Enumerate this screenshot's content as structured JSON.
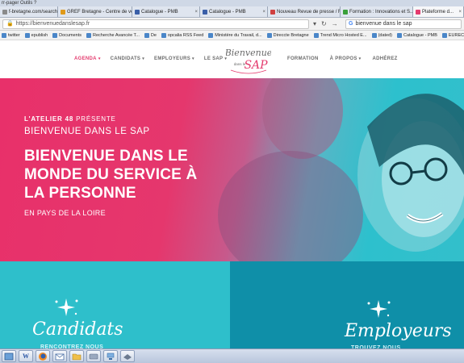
{
  "browser": {
    "top_strip": "rr-pager   Outils   ?",
    "tabs": [
      {
        "label": "f-bretagne.com/search?s=...",
        "color": "#8a8a8a",
        "width": 72
      },
      {
        "label": "GREF Bretagne - Centre de ve...",
        "color": "#e09a1a",
        "width": 92
      },
      {
        "label": "Catalogue - PMB",
        "color": "#3a5fa8",
        "width": 84
      },
      {
        "label": "Catalogue - PMB",
        "color": "#3a5fa8",
        "width": 84
      },
      {
        "label": "Nouveau Revue de presse / R...",
        "color": "#d04040",
        "width": 90
      },
      {
        "label": "Formation : Innovations et S...",
        "color": "#3aa03a",
        "width": 90
      },
      {
        "label": "Plateforme d...",
        "color": "#e43b6e",
        "width": 63,
        "active": true
      }
    ],
    "url": "https://bienvenuedanslesap.fr",
    "search_value": "bienvenue dans le sap",
    "bookmarks": [
      "twitter",
      "epublish",
      "Documents",
      "Recherche Avancée T...",
      "De",
      "opcalia RSS Feed",
      "Ministère du Travail, d...",
      "Direccte Bretagne",
      "Trend Micro Hosted E...",
      "(dated)",
      "Catalogue - PMB",
      "EURECIA / ENTREZ DA..."
    ]
  },
  "site": {
    "nav_left": [
      {
        "label": "AGENDA",
        "caret": "▾",
        "active": true
      },
      {
        "label": "CANDIDATS",
        "caret": "▾"
      },
      {
        "label": "EMPLOYEURS",
        "caret": "▾"
      },
      {
        "label": "LE SAP",
        "caret": "▾"
      }
    ],
    "nav_right": [
      {
        "label": "FORMATION",
        "caret": ""
      },
      {
        "label": "À PROPOS",
        "caret": "▾"
      },
      {
        "label": "ADHÉREZ",
        "caret": ""
      }
    ],
    "logo": {
      "line1": "Bienvenue",
      "line2": "dans le",
      "line3": "SAP"
    }
  },
  "hero": {
    "kicker_bold": "L'ATELIER 48",
    "kicker_light": " PRÉSENTE",
    "subtitle": "BIENVENUE DANS LE SAP",
    "headline_lines": [
      "BIENVENUE DANS LE",
      "MONDE DU SERVICE À",
      "LA PERSONNE"
    ],
    "region": "EN PAYS DE LA LOIRE"
  },
  "panels": {
    "left": {
      "title": "Candidats",
      "subtitle": "RENCONTREZ NOUS"
    },
    "right": {
      "title": "Employeurs",
      "subtitle": "TROUVEZ NOUS"
    }
  },
  "taskbar": {
    "icons": [
      "windows-explorer",
      "word",
      "firefox",
      "mail",
      "folder",
      "disk",
      "network",
      "app"
    ]
  },
  "colors": {
    "brand_pink": "#e43b6e",
    "brand_teal": "#2ebfcb",
    "brand_dark_teal": "#0f8fa8"
  }
}
